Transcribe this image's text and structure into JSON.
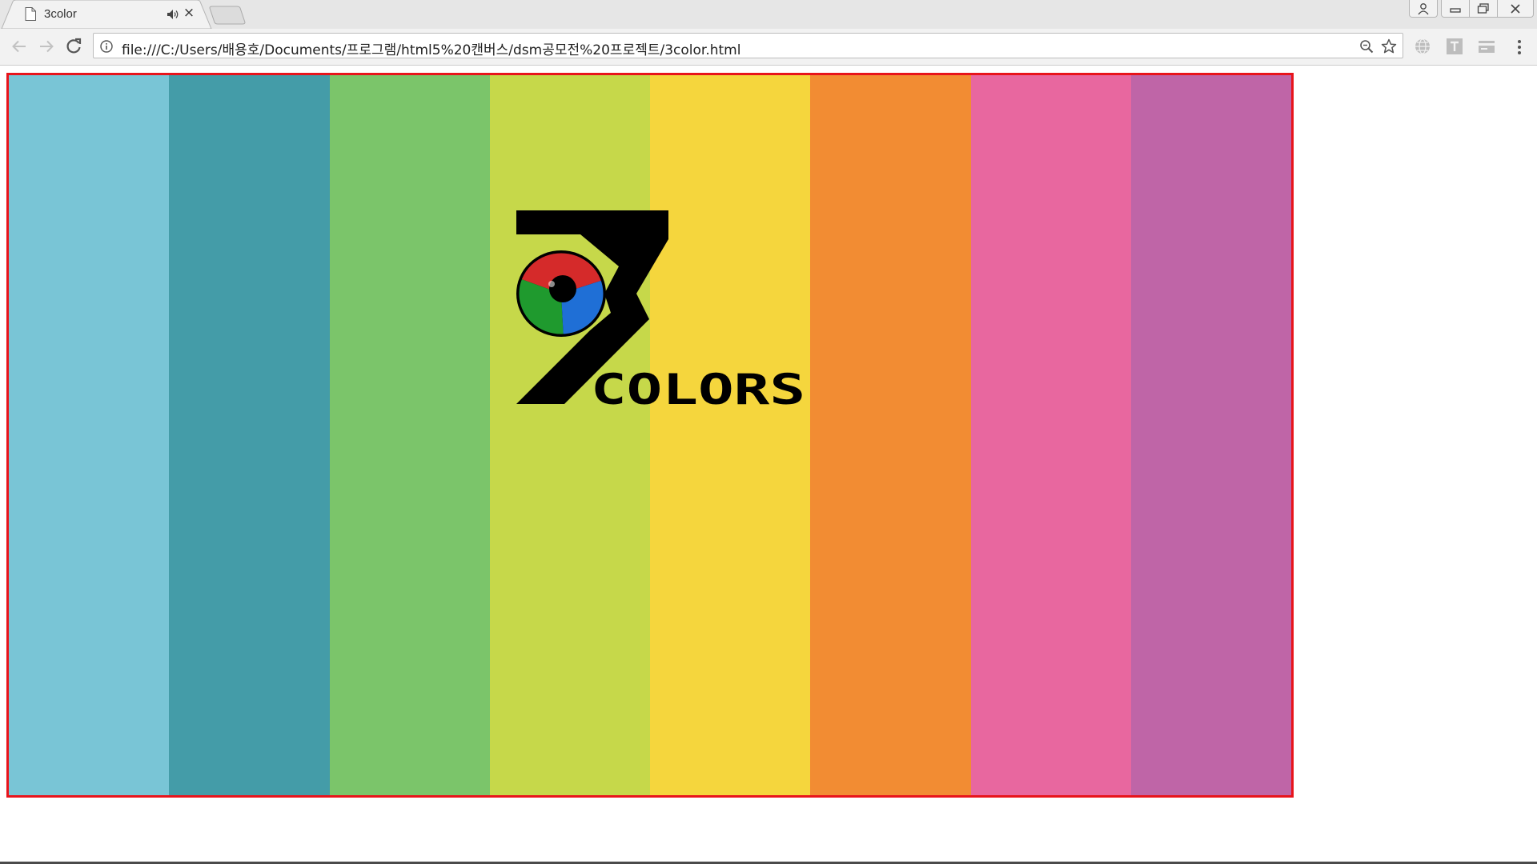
{
  "browser": {
    "tab": {
      "title": "3color",
      "page_icon": "page-icon",
      "audio_icon": "speaker-icon",
      "close_symbol": "×"
    },
    "address_bar": {
      "url": "file:///C:/Users/배용호/Documents/프로그램/html5%20캔버스/dsm공모전%20프로젝트/3color.html"
    },
    "nav_icons": [
      "back-arrow-icon",
      "forward-arrow-icon",
      "reload-icon"
    ],
    "omnibox_icons": [
      "info-icon",
      "zoom-icon",
      "star-icon"
    ],
    "extension_icons": [
      "globe-icon",
      "t-icon",
      "card-icon"
    ],
    "window_icons": [
      "profile-icon",
      "minimize-icon",
      "maximize-icon",
      "close-icon"
    ]
  },
  "page": {
    "frame_color": "#e8141b",
    "stripes": [
      {
        "color": "#79c5d6"
      },
      {
        "color": "#449ca8"
      },
      {
        "color": "#7bc56a"
      },
      {
        "color": "#c6d84a"
      },
      {
        "color": "#f5d63d"
      },
      {
        "color": "#f28c33"
      },
      {
        "color": "#e8679f"
      },
      {
        "color": "#bf65a7"
      }
    ],
    "logo": {
      "numeral": "3",
      "word": "COLORS",
      "eye_colors": [
        "#d52a2a",
        "#1f9a2e",
        "#1f6fd6"
      ]
    }
  }
}
